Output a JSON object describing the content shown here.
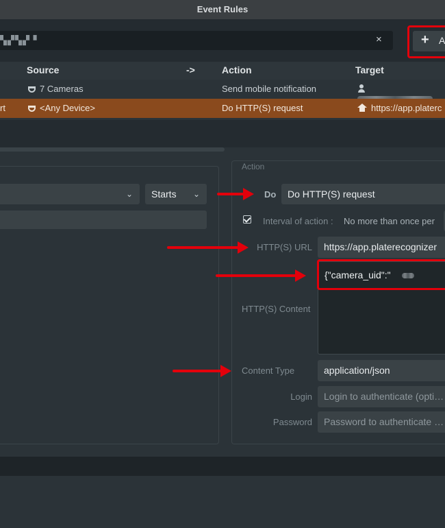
{
  "window": {
    "title": "Event Rules"
  },
  "search": {
    "value": "▚▞▚▞ ▘",
    "clear_icon": "×"
  },
  "toolbar": {
    "add_label": "A",
    "add_icon": "+"
  },
  "table": {
    "headers": {
      "source": "Source",
      "arrow": "->",
      "action": "Action",
      "target": "Target"
    },
    "rows": [
      {
        "lead": "",
        "source": "7 Cameras",
        "action": "Send mobile notification",
        "target": ""
      },
      {
        "lead": "rt",
        "source": "<Any Device>",
        "action": "Do HTTP(S) request",
        "target": "https://app.platerc"
      }
    ]
  },
  "event": {
    "starts": "Starts"
  },
  "action_panel": {
    "title": "Action",
    "do_label": "Do",
    "do_value": "Do HTTP(S) request",
    "interval_label": "Interval of action :",
    "interval_value": "No more than once per",
    "url_label": "HTTP(S) URL",
    "url_value": "https://app.platerecognizer",
    "content_label": "HTTP(S) Content",
    "content_value": "{\"camera_uid\":\"",
    "content_type_label": "Content Type",
    "content_type_value": "application/json",
    "login_label": "Login",
    "login_placeholder": "Login to authenticate (opti…",
    "password_label": "Password",
    "password_placeholder": "Password to authenticate …"
  },
  "colors": {
    "highlight": "#e3000b",
    "selected_row": "#8a4a1d",
    "background": "#2b3338"
  }
}
